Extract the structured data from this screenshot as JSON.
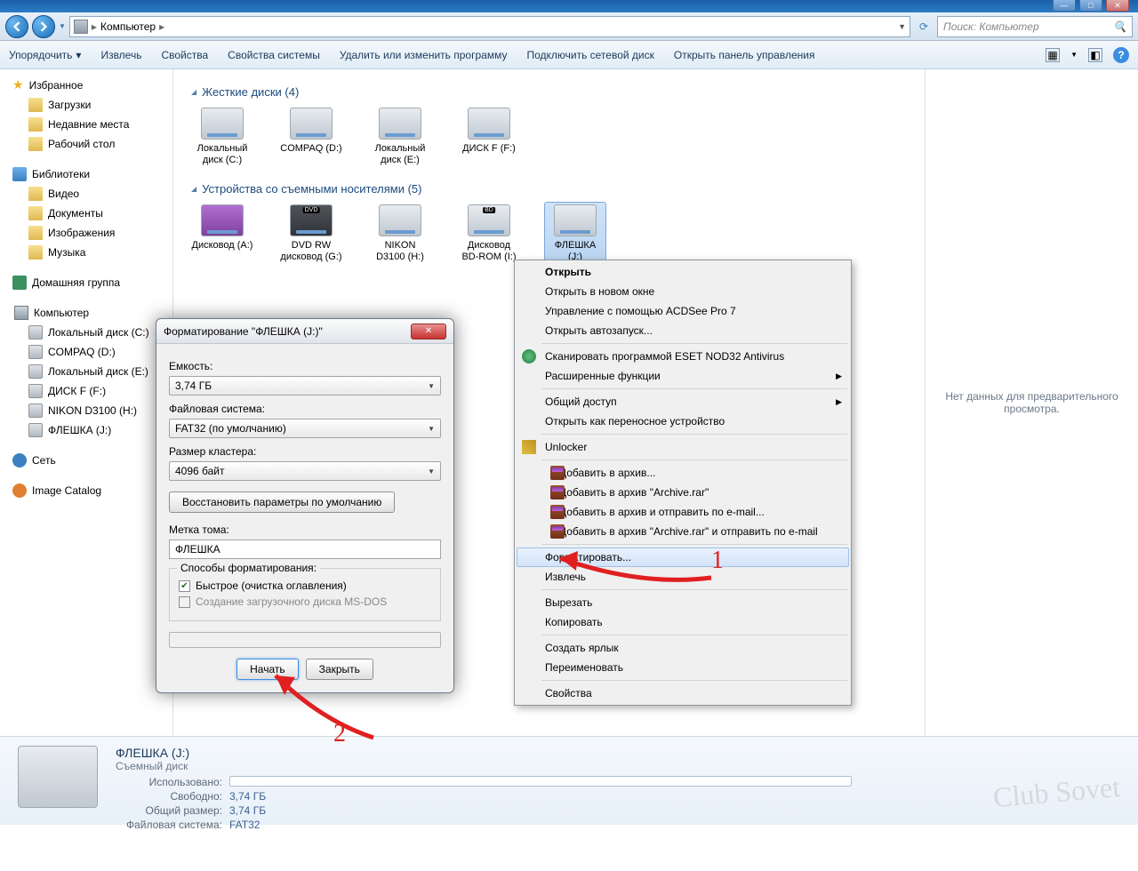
{
  "window": {
    "min": "—",
    "max": "□",
    "close": "✕"
  },
  "nav": {
    "breadcrumb_root": "Компьютер",
    "sep": "▸",
    "refresh": "⟳",
    "search_placeholder": "Поиск: Компьютер",
    "mag": "🔍"
  },
  "toolbar": {
    "organize": "Упорядочить",
    "caret": "▾",
    "eject": "Извлечь",
    "props": "Свойства",
    "sysprops": "Свойства системы",
    "uninstall": "Удалить или изменить программу",
    "mapnet": "Подключить сетевой диск",
    "ctrlpanel": "Открыть панель управления"
  },
  "sidebar": {
    "fav": "Избранное",
    "fav_items": [
      "Загрузки",
      "Недавние места",
      "Рабочий стол"
    ],
    "lib": "Библиотеки",
    "lib_items": [
      "Видео",
      "Документы",
      "Изображения",
      "Музыка"
    ],
    "homegroup": "Домашняя группа",
    "computer": "Компьютер",
    "drives": [
      "Локальный диск (C:)",
      "COMPAQ (D:)",
      "Локальный диск (E:)",
      "ДИСК F (F:)",
      "NIKON D3100 (H:)",
      "ФЛЕШКА (J:)"
    ],
    "network": "Сеть",
    "catalog": "Image Catalog"
  },
  "content": {
    "hdd_header": "Жесткие диски (4)",
    "hdd": [
      "Локальный диск (C:)",
      "COMPAQ (D:)",
      "Локальный диск (E:)",
      "ДИСК F (F:)"
    ],
    "rem_header": "Устройства со съемными носителями (5)",
    "rem": [
      "Дисковод (A:)",
      "DVD RW дисковод (G:)",
      "NIKON D3100 (H:)",
      "Дисковод BD-ROM (I:)",
      "ФЛЕШКА (J:)"
    ]
  },
  "preview": "Нет данных для предварительного просмотра.",
  "details": {
    "title": "ФЛЕШКА (J:)",
    "type": "Съемный диск",
    "used_lbl": "Использовано:",
    "free_lbl": "Свободно:",
    "free": "3,74 ГБ",
    "total_lbl": "Общий размер:",
    "total": "3,74 ГБ",
    "fs_lbl": "Файловая система:",
    "fs": "FAT32"
  },
  "dialog": {
    "title": "Форматирование \"ФЛЕШКА (J:)\"",
    "cap_lbl": "Емкость:",
    "cap": "3,74 ГБ",
    "fs_lbl": "Файловая система:",
    "fs": "FAT32 (по умолчанию)",
    "cluster_lbl": "Размер кластера:",
    "cluster": "4096 байт",
    "restore": "Восстановить параметры по умолчанию",
    "vol_lbl": "Метка тома:",
    "vol": "ФЛЕШКА",
    "methods": "Способы форматирования:",
    "quick": "Быстрое (очистка оглавления)",
    "msdos": "Создание загрузочного диска MS-DOS",
    "start": "Начать",
    "close": "Закрыть"
  },
  "ctx": {
    "open": "Открыть",
    "open_new": "Открыть в новом окне",
    "acdsee": "Управление с помощью ACDSee Pro 7",
    "autoplay": "Открыть автозапуск...",
    "eset": "Сканировать программой ESET NOD32 Antivirus",
    "adv": "Расширенные функции",
    "share": "Общий доступ",
    "portable": "Открыть как переносное устройство",
    "unlocker": "Unlocker",
    "rar1": "Добавить в архив...",
    "rar2": "Добавить в архив \"Archive.rar\"",
    "rar3": "Добавить в архив и отправить по e-mail...",
    "rar4": "Добавить в архив \"Archive.rar\" и отправить по e-mail",
    "format": "Форматировать...",
    "eject": "Извлечь",
    "cut": "Вырезать",
    "copy": "Копировать",
    "shortcut": "Создать ярлык",
    "rename": "Переименовать",
    "props": "Свойства"
  },
  "anno": {
    "a1": "1",
    "a2": "2"
  },
  "watermark": "Club Sovet"
}
